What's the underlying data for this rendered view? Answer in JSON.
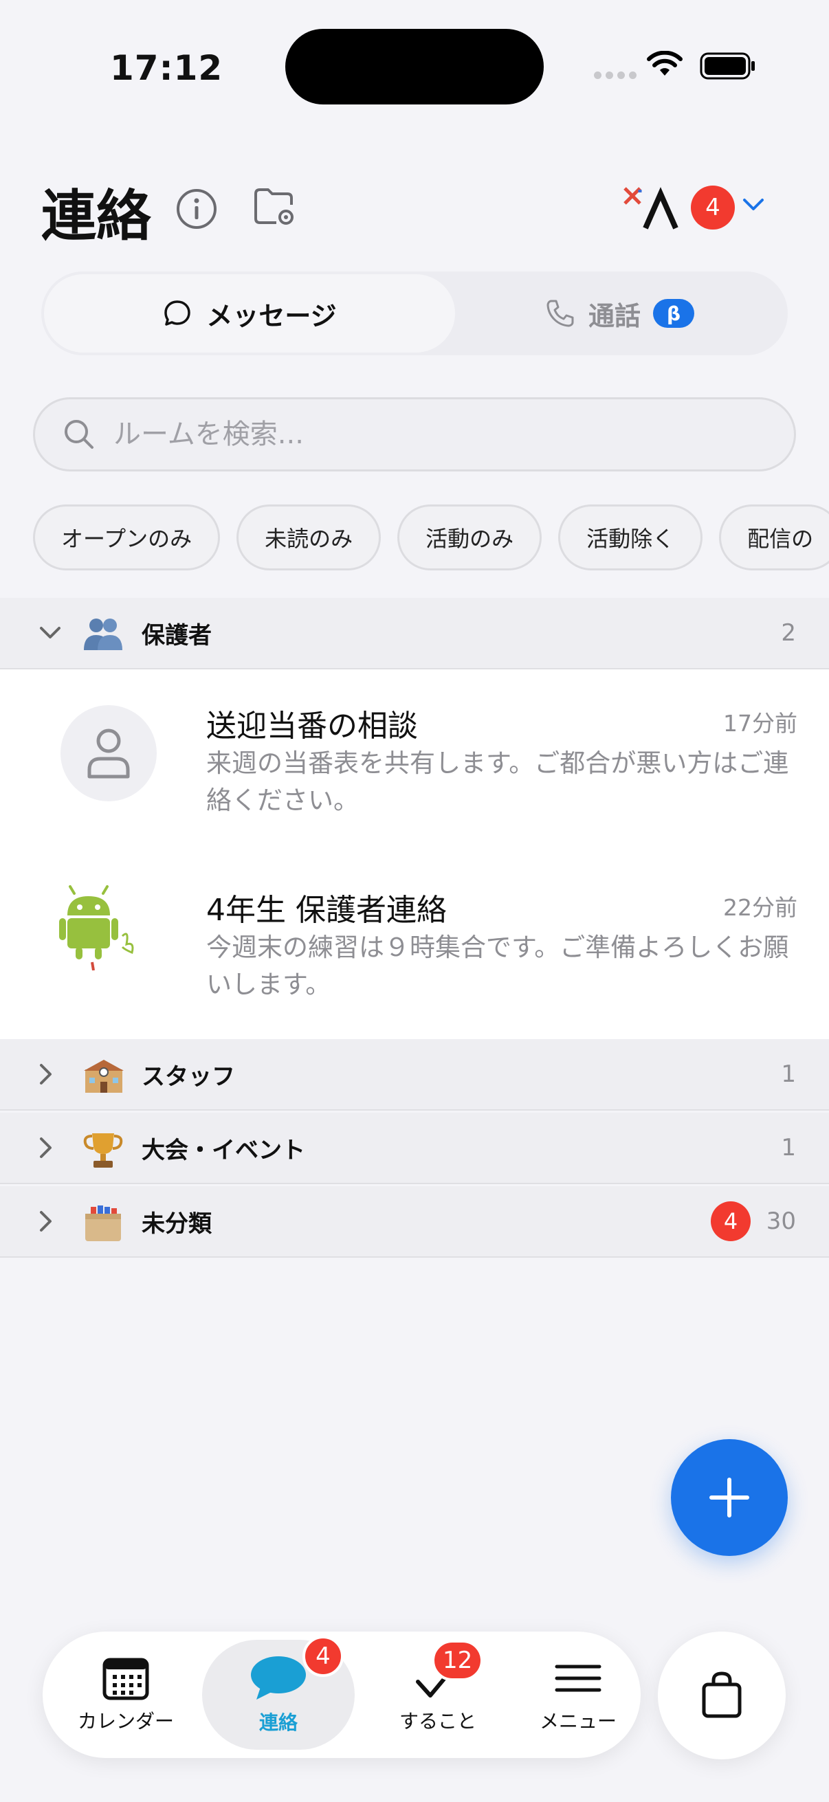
{
  "status_bar": {
    "time": "17:12"
  },
  "header": {
    "title": "連絡",
    "notification_count": "4"
  },
  "segmented": {
    "messages_label": "メッセージ",
    "calls_label": "通話",
    "beta_label": "β"
  },
  "search": {
    "placeholder": "ルームを検索..."
  },
  "filters": [
    "オープンのみ",
    "未読のみ",
    "活動のみ",
    "活動除く",
    "配信の"
  ],
  "groups": [
    {
      "label": "保護者",
      "count": "2",
      "emoji": "👥"
    },
    {
      "label": "スタッフ",
      "count": "1",
      "emoji": "🏫"
    },
    {
      "label": "大会・イベント",
      "count": "1",
      "emoji": "🏆"
    },
    {
      "label": "未分類",
      "count": "30",
      "unread": "4",
      "emoji": "🗂️"
    }
  ],
  "chats": [
    {
      "title": "送迎当番の相談",
      "time": "17分前",
      "preview": "来週の当番表を共有します。ご都合が悪い方はご連絡ください。"
    },
    {
      "title": "4年生 保護者連絡",
      "time": "22分前",
      "preview": "今週末の練習は９時集合です。ご準備よろしくお願いします。"
    }
  ],
  "tabbar": {
    "calendar_label": "カレンダー",
    "contact_label": "連絡",
    "contact_badge": "4",
    "todo_label": "すること",
    "todo_badge": "12",
    "menu_label": "メニュー"
  },
  "colors": {
    "accent": "#1a73e8",
    "badge": "#f23a2f",
    "active_tab": "#1a9fd4"
  }
}
